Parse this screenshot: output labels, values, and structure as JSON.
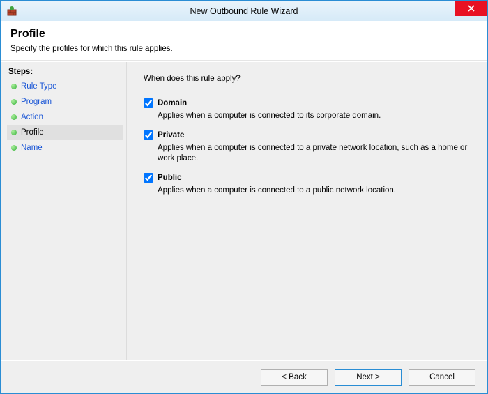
{
  "window": {
    "title": "New Outbound Rule Wizard"
  },
  "header": {
    "heading": "Profile",
    "subtitle": "Specify the profiles for which this rule applies."
  },
  "sidebar": {
    "heading": "Steps:",
    "steps": [
      {
        "label": "Rule Type",
        "active": false
      },
      {
        "label": "Program",
        "active": false
      },
      {
        "label": "Action",
        "active": false
      },
      {
        "label": "Profile",
        "active": true
      },
      {
        "label": "Name",
        "active": false
      }
    ]
  },
  "content": {
    "prompt": "When does this rule apply?",
    "options": [
      {
        "key": "domain",
        "label": "Domain",
        "checked": true,
        "desc": "Applies when a computer is connected to its corporate domain."
      },
      {
        "key": "private",
        "label": "Private",
        "checked": true,
        "desc": "Applies when a computer is connected to a private network location, such as a home or work place."
      },
      {
        "key": "public",
        "label": "Public",
        "checked": true,
        "desc": "Applies when a computer is connected to a public network location."
      }
    ]
  },
  "footer": {
    "back": "< Back",
    "next": "Next >",
    "cancel": "Cancel"
  }
}
